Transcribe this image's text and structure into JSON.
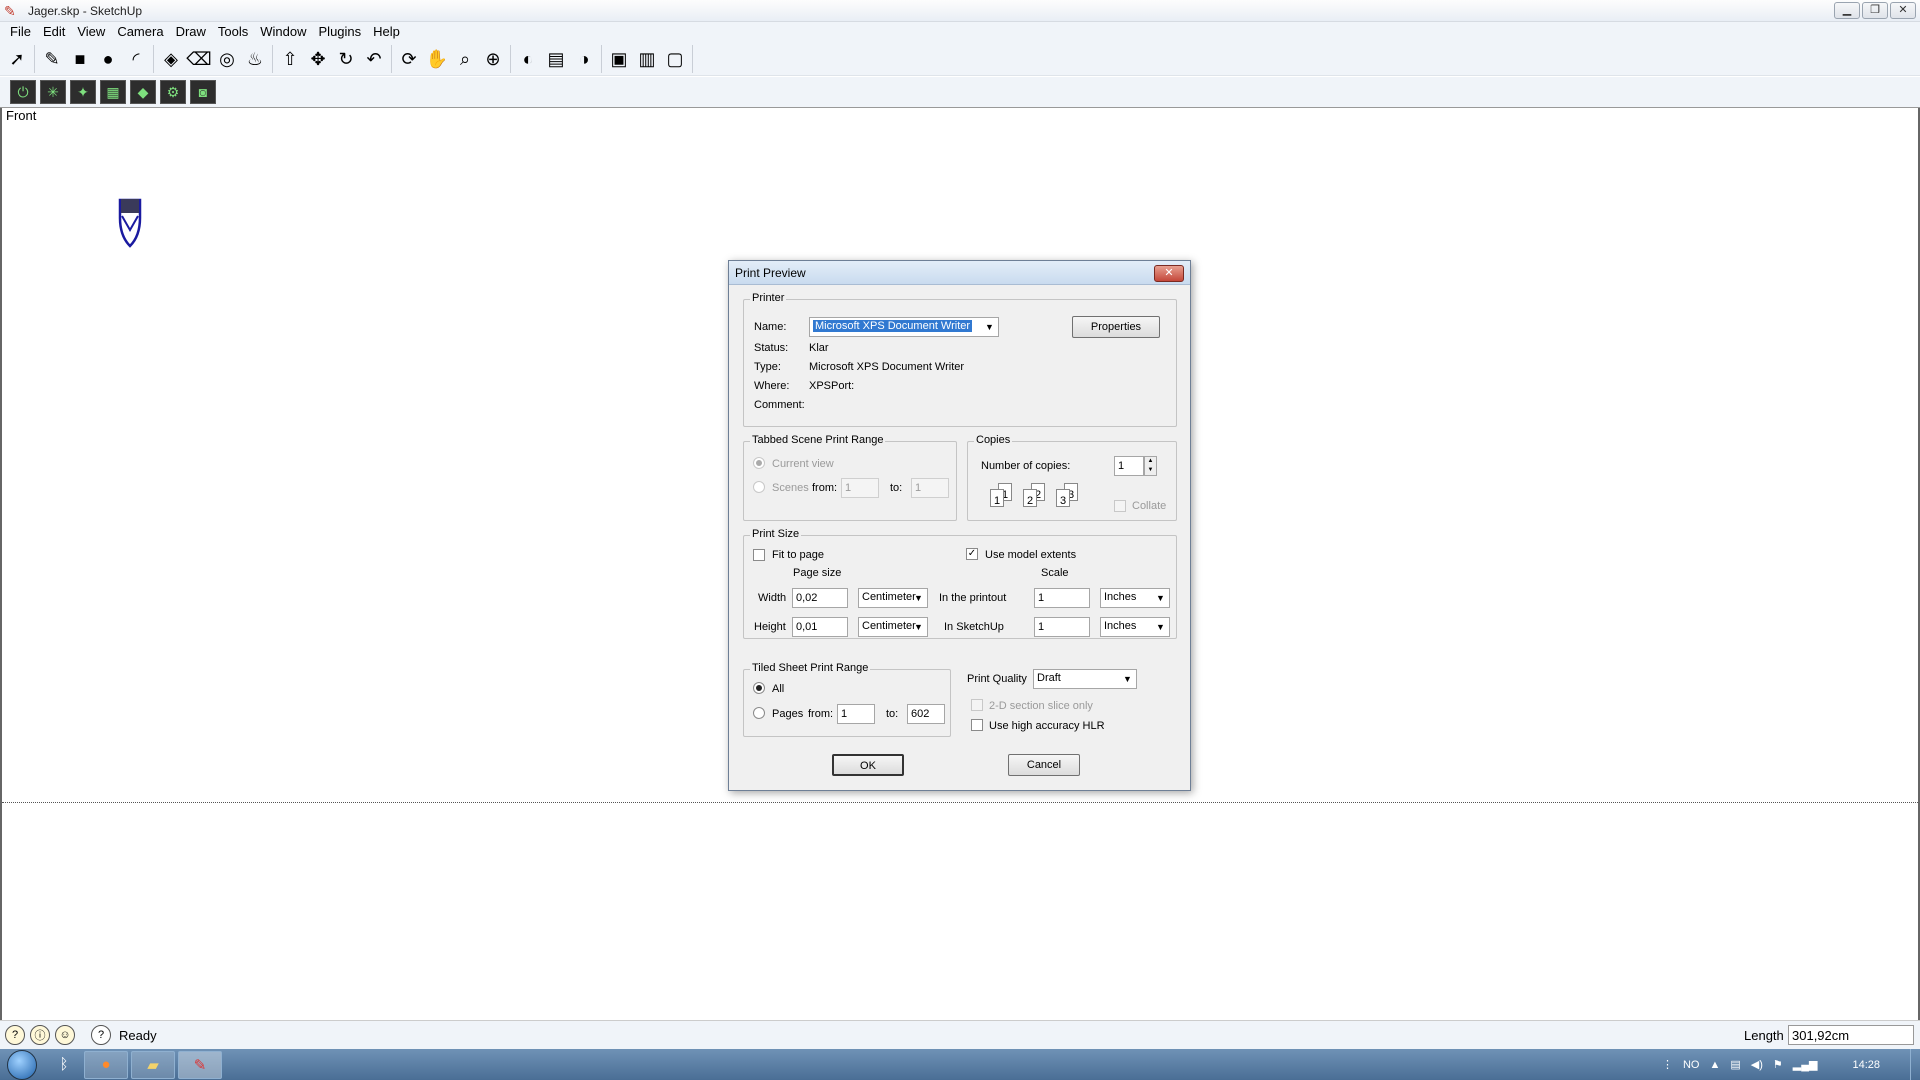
{
  "window": {
    "title": "Jager.skp - SketchUp",
    "controls": [
      "▁",
      "❐",
      "✕"
    ]
  },
  "menu": [
    "File",
    "Edit",
    "View",
    "Camera",
    "Draw",
    "Tools",
    "Window",
    "Plugins",
    "Help"
  ],
  "toolbar1": {
    "groups": [
      [
        {
          "icon": "select-arrow-icon",
          "glyph": "➚"
        }
      ],
      [
        {
          "icon": "pencil-line-icon",
          "glyph": "✎"
        },
        {
          "icon": "rectangle-icon",
          "glyph": "■"
        },
        {
          "icon": "circle-icon",
          "glyph": "●"
        },
        {
          "icon": "arc-icon",
          "glyph": "◜"
        }
      ],
      [
        {
          "icon": "make-component-icon",
          "glyph": "◈"
        },
        {
          "icon": "eraser-icon",
          "glyph": "⌫"
        },
        {
          "icon": "tape-measure-icon",
          "glyph": "◎"
        },
        {
          "icon": "paint-bucket-icon",
          "glyph": "♨"
        }
      ],
      [
        {
          "icon": "push-pull-icon",
          "glyph": "⇧"
        },
        {
          "icon": "move-icon",
          "glyph": "✥"
        },
        {
          "icon": "rotate-icon",
          "glyph": "↻"
        },
        {
          "icon": "offset-icon",
          "glyph": "↶"
        }
      ],
      [
        {
          "icon": "orbit-icon",
          "glyph": "⟳"
        },
        {
          "icon": "pan-hand-icon",
          "glyph": "✋"
        },
        {
          "icon": "zoom-icon",
          "glyph": "⌕"
        },
        {
          "icon": "zoom-extents-icon",
          "glyph": "⊕"
        }
      ],
      [
        {
          "icon": "get-models-icon",
          "glyph": "◐"
        },
        {
          "icon": "share-model-icon",
          "glyph": "▤"
        },
        {
          "icon": "google-earth-icon",
          "glyph": "◑"
        }
      ],
      [
        {
          "icon": "get-component-icon",
          "glyph": "▣"
        },
        {
          "icon": "share-component-icon",
          "glyph": "▥"
        },
        {
          "icon": "extension-warehouse-icon",
          "glyph": "▢"
        }
      ]
    ]
  },
  "toolbar2": {
    "buttons": [
      {
        "icon": "power-icon",
        "glyph": "⏻"
      },
      {
        "icon": "sun-light-icon",
        "glyph": "✳"
      },
      {
        "icon": "spot-light-icon",
        "glyph": "✦"
      },
      {
        "icon": "texture-tool-icon",
        "glyph": "▦"
      },
      {
        "icon": "render-icon",
        "glyph": "◆"
      },
      {
        "icon": "settings-gear-icon",
        "glyph": "⚙"
      },
      {
        "icon": "camera-icon",
        "glyph": "◙"
      }
    ]
  },
  "canvas": {
    "scene_label": "Front"
  },
  "dialog": {
    "title": "Print Preview",
    "close": "✕",
    "printer": {
      "group_title": "Printer",
      "name_label": "Name:",
      "name_value": "Microsoft XPS Document Writer",
      "properties_label": "Properties",
      "status_label": "Status:",
      "status_value": "Klar",
      "type_label": "Type:",
      "type_value": "Microsoft XPS Document Writer",
      "where_label": "Where:",
      "where_value": "XPSPort:",
      "comment_label": "Comment:",
      "comment_value": ""
    },
    "scene_range": {
      "group_title": "Tabbed Scene Print Range",
      "current_view": "Current view",
      "scenes": "Scenes",
      "from_label": "from:",
      "from_value": "1",
      "to_label": "to:",
      "to_value": "1"
    },
    "copies": {
      "group_title": "Copies",
      "number_label": "Number of copies:",
      "number_value": "1",
      "collate_label": "Collate",
      "page_numbers": [
        "1",
        "1",
        "2",
        "2",
        "3",
        "3"
      ]
    },
    "print_size": {
      "group_title": "Print Size",
      "fit_to_page": "Fit to page",
      "use_model_extents": "Use model extents",
      "page_size_label": "Page size",
      "scale_label": "Scale",
      "width_label": "Width",
      "width_value": "0,02",
      "width_unit": "Centimeter",
      "height_label": "Height",
      "height_value": "0,01",
      "height_unit": "Centimeter",
      "in_printout_label": "In the printout",
      "in_printout_value": "1",
      "in_printout_unit": "Inches",
      "in_sketchup_label": "In SketchUp",
      "in_sketchup_value": "1",
      "in_sketchup_unit": "Inches"
    },
    "tiled_range": {
      "group_title": "Tiled Sheet Print Range",
      "all_label": "All",
      "pages_label": "Pages",
      "from_label": "from:",
      "from_value": "1",
      "to_label": "to:",
      "to_value": "602"
    },
    "quality": {
      "label": "Print Quality",
      "value": "Draft",
      "section_slice": "2-D section slice only",
      "high_accuracy": "Use high accuracy HLR"
    },
    "ok_label": "OK",
    "cancel_label": "Cancel"
  },
  "statusbar": {
    "status_text": "Ready",
    "length_label": "Length",
    "length_value": "301,92cm"
  },
  "taskbar": {
    "tray": {
      "language": "NO",
      "clock": "14:28"
    }
  }
}
